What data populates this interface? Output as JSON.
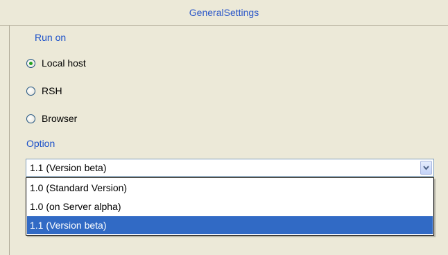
{
  "title": "GeneralSettings",
  "run_on": {
    "label": "Run on",
    "options": [
      {
        "label": "Local host",
        "checked": true
      },
      {
        "label": "RSH",
        "checked": false
      },
      {
        "label": "Browser",
        "checked": false
      }
    ]
  },
  "option": {
    "label": "Option",
    "selected_value": "1.1 (Version beta)",
    "items": [
      "1.0 (Standard Version)",
      "1.0 (on Server alpha)",
      "1.1 (Version beta)"
    ],
    "highlighted_index": 2
  },
  "colors": {
    "accent": "#316ac5",
    "label_blue": "#1b50c9",
    "radio_dot": "#21a121"
  }
}
